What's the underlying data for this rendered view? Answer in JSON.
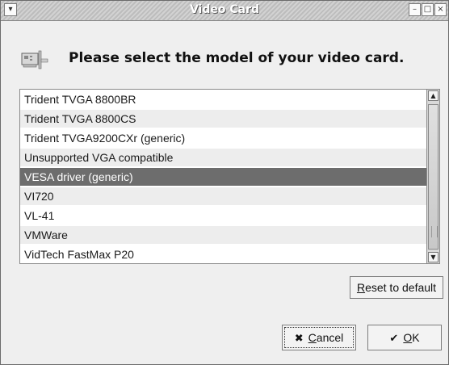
{
  "window": {
    "title": "Video Card"
  },
  "header": {
    "text": "Please select the model of your video card."
  },
  "list": {
    "items": [
      "Trident TVGA 8800BR",
      "Trident TVGA 8800CS",
      "Trident TVGA9200CXr (generic)",
      "Unsupported VGA compatible",
      "VESA driver (generic)",
      "VI720",
      "VL-41",
      "VMWare",
      "VidTech FastMax P20"
    ],
    "selected_index": 4
  },
  "buttons": {
    "reset": {
      "prefix": "",
      "accel": "R",
      "rest": "eset to default"
    },
    "cancel": {
      "icon": "cancel-icon",
      "accel": "C",
      "rest": "ancel"
    },
    "ok": {
      "icon": "ok-icon",
      "accel": "O",
      "rest": "K"
    }
  },
  "colors": {
    "selection": "#6d6d6d",
    "row_alt": "#ededed"
  }
}
